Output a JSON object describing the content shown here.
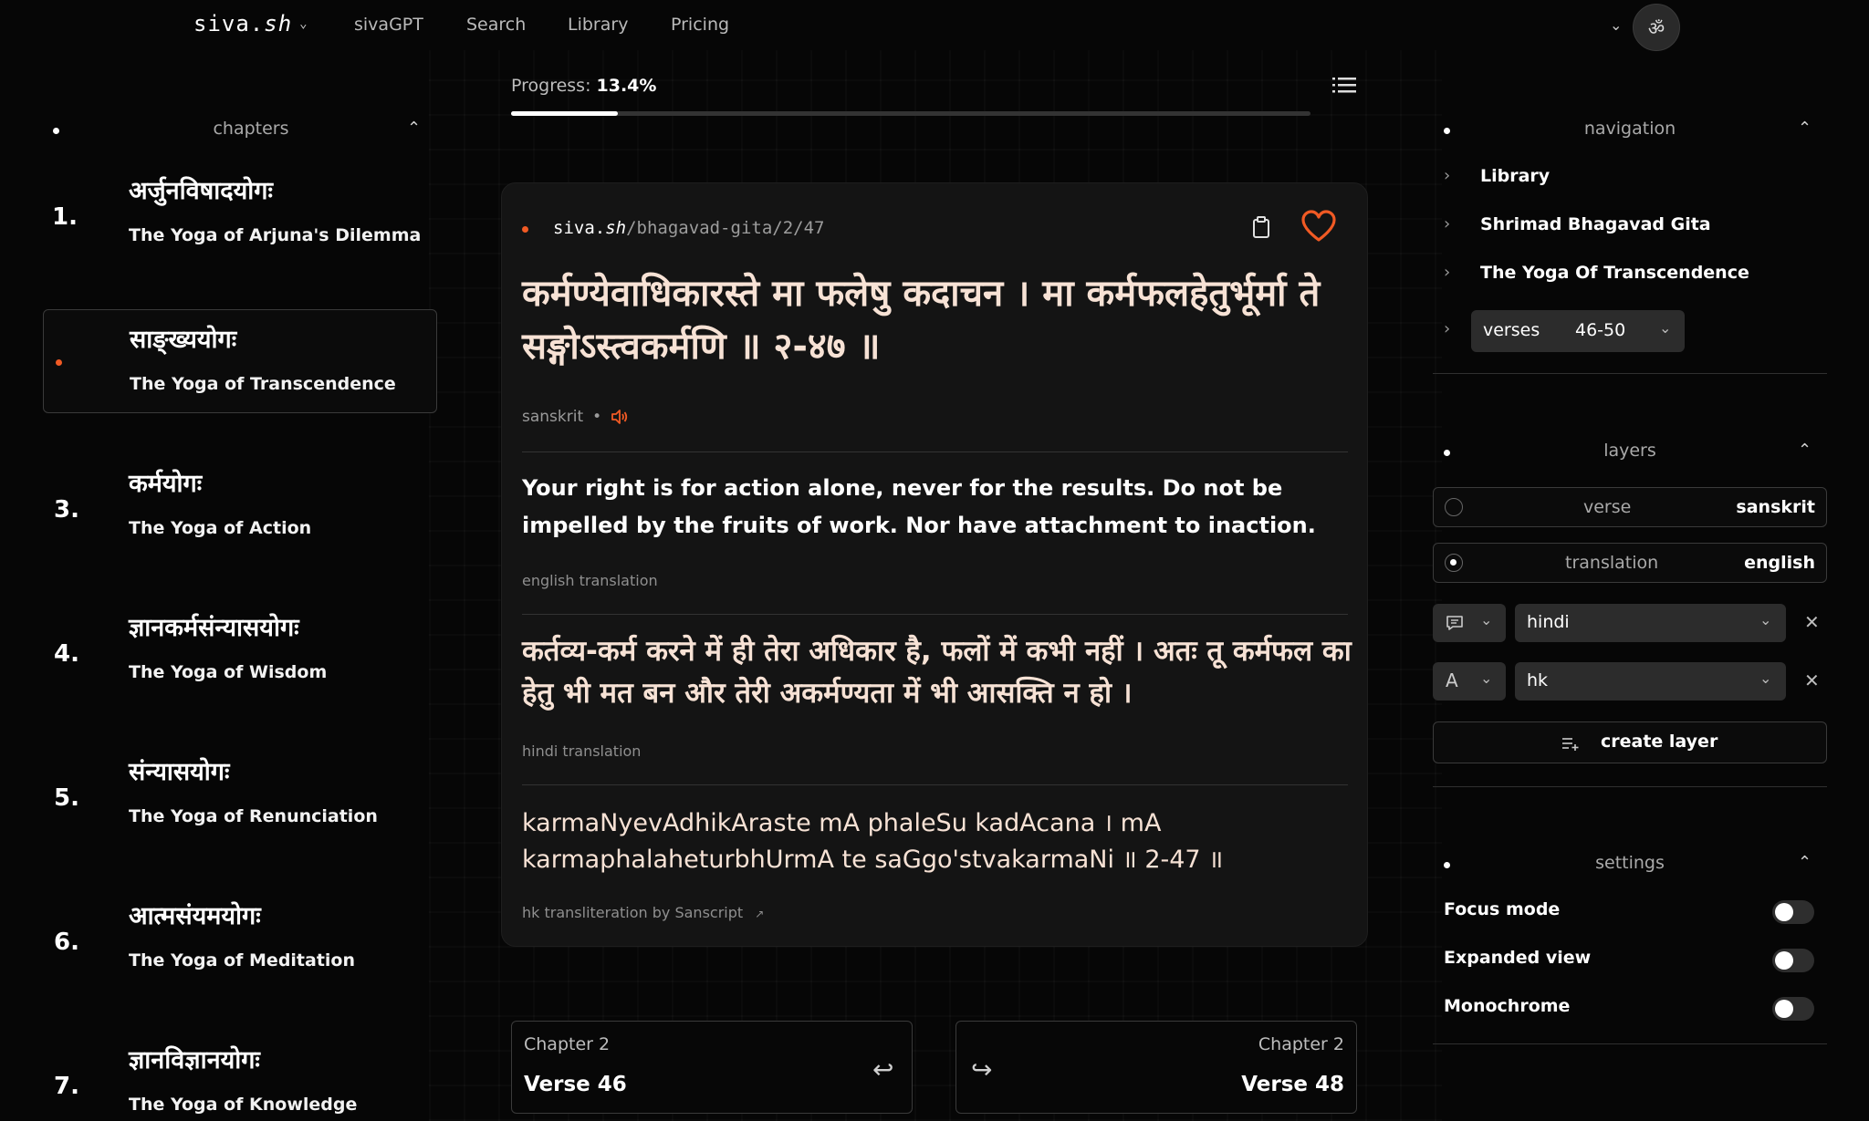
{
  "topbar": {
    "brand_main": "siva",
    "brand_dot": ".",
    "brand_sh": "sh",
    "nav": [
      "sivaGPT",
      "Search",
      "Library",
      "Pricing"
    ],
    "theme_glyph": "ॐ"
  },
  "left": {
    "title": "chapters",
    "chapters": [
      {
        "num": "1.",
        "dev": "अर्जुनविषादयोगः",
        "en": "The Yoga of Arjuna's Dilemma"
      },
      {
        "num": "",
        "dev": "साङ्ख्ययोगः",
        "en": "The Yoga of Transcendence"
      },
      {
        "num": "3.",
        "dev": "कर्मयोगः",
        "en": "The Yoga of Action"
      },
      {
        "num": "4.",
        "dev": "ज्ञानकर्मसंन्यासयोगः",
        "en": "The Yoga of Wisdom"
      },
      {
        "num": "5.",
        "dev": "संन्यासयोगः",
        "en": "The Yoga of Renunciation"
      },
      {
        "num": "6.",
        "dev": "आत्मसंयमयोगः",
        "en": "The Yoga of Meditation"
      },
      {
        "num": "7.",
        "dev": "ज्ञानविज्ञानयोगः",
        "en": "The Yoga of Knowledge"
      }
    ]
  },
  "progress": {
    "label": "Progress:",
    "value": "13.4%",
    "fraction": 0.134
  },
  "card": {
    "url_host": "siva",
    "url_dot": ".",
    "url_sh": "sh",
    "url_path": "/bhagavad-gita/2/47",
    "sanskrit": "कर्मण्येवाधिकारस्ते मा फलेषु कदाचन  । मा कर्मफलहेतुर्भूर्मा ते सङ्गोऽस्त्वकर्मणि  ॥ २-४७  ॥",
    "sanskrit_label": "sanskrit",
    "meta_sep": "•",
    "english": "Your right is for action alone, never for the results. Do not be impelled by the fruits of work. Nor have attachment to inaction.",
    "english_caption": "english translation",
    "hindi": "कर्तव्य-कर्म करने में ही तेरा अधिकार है, फलों में कभी नहीं । अतः तू कर्मफल का हेतु भी मत बन और तेरी अकर्मण्यता में भी आसक्ति न हो ।",
    "hindi_caption": "hindi translation",
    "hk": "karmaNyevAdhikAraste mA phaleSu kadAcana  । mA karmaphalaheturbhUrmA te saGgo'stvakarmaNi  ॥ 2-47  ॥",
    "hk_caption": "hk transliteration by Sanscript",
    "hk_caption_arrow": "↗"
  },
  "verse_nav": {
    "prev": {
      "chapter": "Chapter 2",
      "verse": "Verse 46",
      "arrow": "↩"
    },
    "next": {
      "chapter": "Chapter 2",
      "verse": "Verse 48",
      "arrow": "↪"
    }
  },
  "right": {
    "navigation_title": "navigation",
    "crumbs": [
      "Library",
      "Shrimad Bhagavad Gita",
      "The Yoga Of Transcendence"
    ],
    "verses_label": "verses",
    "verses_range": "46-50",
    "layers_title": "layers",
    "layers": [
      {
        "name": "verse",
        "lang": "sanskrit"
      },
      {
        "name": "translation",
        "lang": "english"
      }
    ],
    "extra_layers": [
      "hindi",
      "hk"
    ],
    "create_label": "create layer",
    "settings_title": "settings",
    "settings": [
      "Focus mode",
      "Expanded view",
      "Monochrome"
    ]
  },
  "colors": {
    "accent": "#f15a24",
    "background": "#060606",
    "card": "#141414"
  }
}
